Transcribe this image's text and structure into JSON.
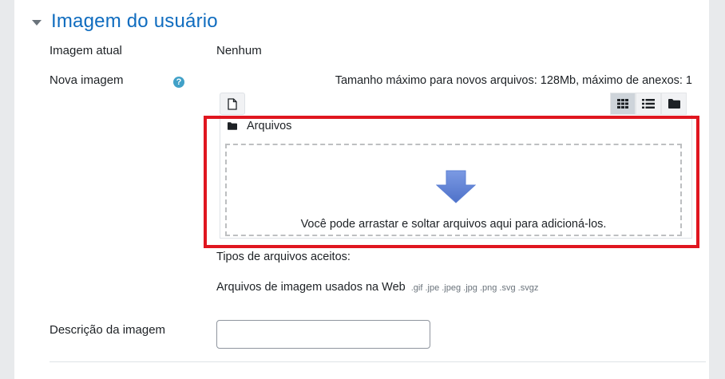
{
  "section": {
    "title": "Imagem do usuário"
  },
  "fields": {
    "current_image_label": "Imagem atual",
    "current_image_value": "Nenhum",
    "new_image_label": "Nova imagem",
    "max_size_text": "Tamanho máximo para novos arquivos: 128Mb, máximo de anexos: 1",
    "image_description_label": "Descrição da imagem",
    "image_description_value": ""
  },
  "filemanager": {
    "path_label": "Arquivos",
    "drop_text": "Você pode arrastar e soltar arquivos aqui para adicioná-los.",
    "view_buttons": [
      "icons",
      "list",
      "tree"
    ],
    "active_view": "icons"
  },
  "accepted_types": {
    "label": "Tipos de arquivos aceitos:",
    "group_name": "Arquivos de imagem usados na Web",
    "extensions": ".gif .jpe .jpeg .jpg .png .svg .svgz"
  },
  "colors": {
    "accent": "#0f6cbf",
    "highlight": "#e0161f",
    "help": "#41a1c8",
    "drop_arrow": "#5b7fd3"
  }
}
